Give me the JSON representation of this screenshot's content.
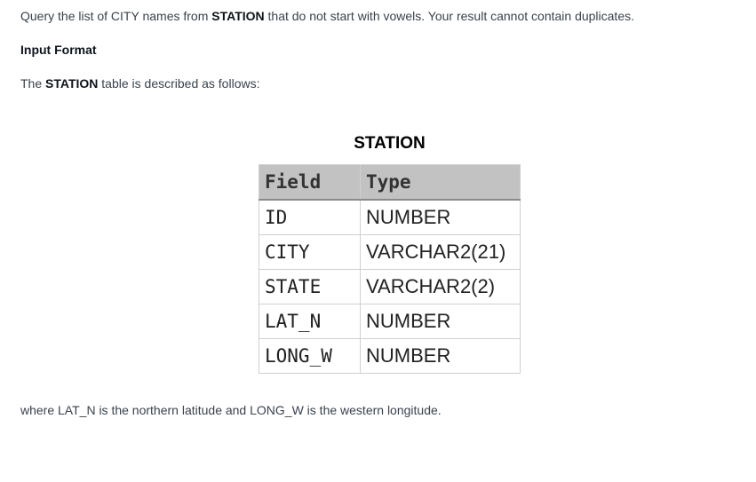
{
  "intro": {
    "before": "Query the list of CITY names from ",
    "bold": "STATION",
    "after": " that do not start with vowels. Your result cannot contain duplicates."
  },
  "input_format_heading": "Input Format",
  "table_description": {
    "before": "The ",
    "bold": "STATION",
    "after": " table is described as follows:"
  },
  "table": {
    "caption": "STATION",
    "headers": {
      "field": "Field",
      "type": "Type"
    },
    "rows": [
      {
        "field": "ID",
        "type": "NUMBER"
      },
      {
        "field": "CITY",
        "type": "VARCHAR2(21)"
      },
      {
        "field": "STATE",
        "type": "VARCHAR2(2)"
      },
      {
        "field": "LAT_N",
        "type": "NUMBER"
      },
      {
        "field": "LONG_W",
        "type": "NUMBER"
      }
    ]
  },
  "where_note": "where LAT_N is the northern latitude and LONG_W is the western longitude."
}
